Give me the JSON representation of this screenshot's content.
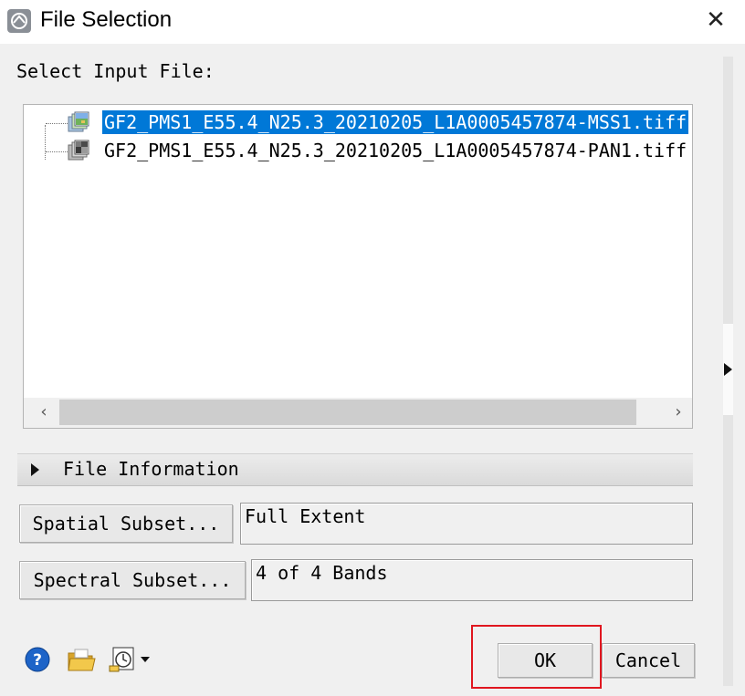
{
  "window": {
    "title": "File Selection",
    "close_glyph": "✕",
    "icon": "app-logo-icon"
  },
  "select_label": "Select Input File:",
  "files": [
    {
      "name": "GF2_PMS1_E55.4_N25.3_20210205_L1A0005457874-MSS1.tiff",
      "icon": "multispectral-image-icon",
      "selected": true
    },
    {
      "name": "GF2_PMS1_E55.4_N25.3_20210205_L1A0005457874-PAN1.tiff",
      "icon": "panchromatic-image-icon",
      "selected": false
    }
  ],
  "scroll": {
    "left_glyph": "‹",
    "right_glyph": "›"
  },
  "file_info": {
    "label": "File Information"
  },
  "spatial": {
    "button": "Spatial Subset...",
    "value": "Full Extent"
  },
  "spectral": {
    "button": "Spectral Subset...",
    "value": "4 of 4 Bands"
  },
  "bottom_icons": [
    "help-icon",
    "open-folder-icon",
    "options-dropdown-icon"
  ],
  "buttons": {
    "ok": "OK",
    "cancel": "Cancel"
  },
  "colors": {
    "selection": "#0078d7",
    "highlight_box": "#e0161f",
    "help_blue": "#1e64c8",
    "folder_yellow": "#f2c84b"
  }
}
